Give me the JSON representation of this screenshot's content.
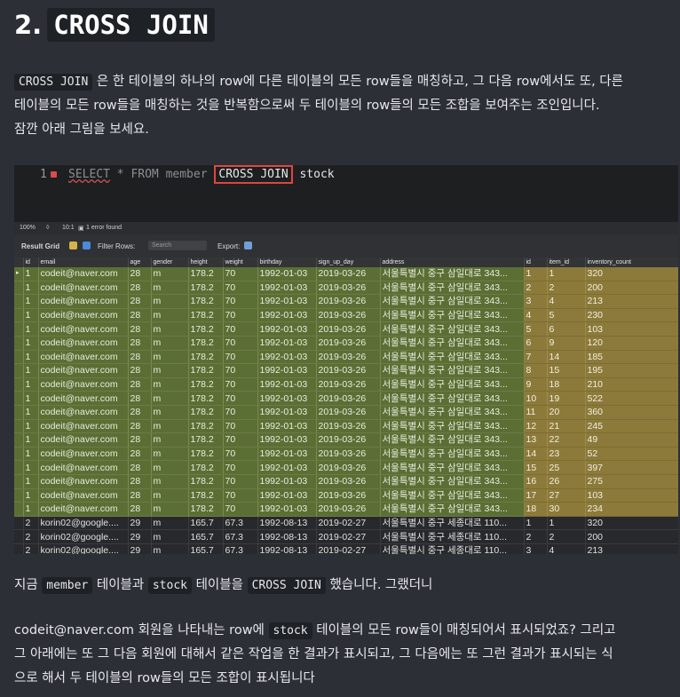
{
  "heading": {
    "number": "2.",
    "code": "CROSS JOIN"
  },
  "intro": {
    "code": "CROSS JOIN",
    "text_line1": " 은 한 테이블의 하나의 row에 다른 테이블의 모든 row들을 매칭하고, 그 다음 row에서도 또, 다른",
    "text_line2": "테이블의 모든 row들을 매칭하는 것을 반복함으로써 두 테이블의 row들의 모든 조합을 보여주는 조인입니다.",
    "text_line3": "잠깐 아래 그림을 보세요."
  },
  "editor": {
    "line_number": "1",
    "kw_select": "SELECT",
    "rest_before": " * FROM member ",
    "highlight": "CROSS JOIN",
    "table": " stock"
  },
  "statusbar": {
    "zoom": "100%",
    "position": "10:1",
    "errors": "1 error found"
  },
  "toolbar": {
    "result_grid": "Result Grid",
    "filter_rows": "Filter Rows:",
    "search_placeholder": "Search",
    "export": "Export:"
  },
  "columns": [
    "id",
    "email",
    "age",
    "gender",
    "height",
    "weight",
    "birthday",
    "sign_up_day",
    "address",
    "id",
    "item_id",
    "inventory_count"
  ],
  "rows": [
    [
      "1",
      "codeit@naver.com",
      "28",
      "m",
      "178.2",
      "70",
      "1992-01-03",
      "2019-03-26",
      "서울특별시 중구 삼일대로 343...",
      "1",
      "1",
      "320"
    ],
    [
      "1",
      "codeit@naver.com",
      "28",
      "m",
      "178.2",
      "70",
      "1992-01-03",
      "2019-03-26",
      "서울특별시 중구 삼일대로 343...",
      "2",
      "2",
      "200"
    ],
    [
      "1",
      "codeit@naver.com",
      "28",
      "m",
      "178.2",
      "70",
      "1992-01-03",
      "2019-03-26",
      "서울특별시 중구 삼일대로 343...",
      "3",
      "4",
      "213"
    ],
    [
      "1",
      "codeit@naver.com",
      "28",
      "m",
      "178.2",
      "70",
      "1992-01-03",
      "2019-03-26",
      "서울특별시 중구 삼일대로 343...",
      "4",
      "5",
      "230"
    ],
    [
      "1",
      "codeit@naver.com",
      "28",
      "m",
      "178.2",
      "70",
      "1992-01-03",
      "2019-03-26",
      "서울특별시 중구 삼일대로 343...",
      "5",
      "6",
      "103"
    ],
    [
      "1",
      "codeit@naver.com",
      "28",
      "m",
      "178.2",
      "70",
      "1992-01-03",
      "2019-03-26",
      "서울특별시 중구 삼일대로 343...",
      "6",
      "9",
      "120"
    ],
    [
      "1",
      "codeit@naver.com",
      "28",
      "m",
      "178.2",
      "70",
      "1992-01-03",
      "2019-03-26",
      "서울특별시 중구 삼일대로 343...",
      "7",
      "14",
      "185"
    ],
    [
      "1",
      "codeit@naver.com",
      "28",
      "m",
      "178.2",
      "70",
      "1992-01-03",
      "2019-03-26",
      "서울특별시 중구 삼일대로 343...",
      "8",
      "15",
      "195"
    ],
    [
      "1",
      "codeit@naver.com",
      "28",
      "m",
      "178.2",
      "70",
      "1992-01-03",
      "2019-03-26",
      "서울특별시 중구 삼일대로 343...",
      "9",
      "18",
      "210"
    ],
    [
      "1",
      "codeit@naver.com",
      "28",
      "m",
      "178.2",
      "70",
      "1992-01-03",
      "2019-03-26",
      "서울특별시 중구 삼일대로 343...",
      "10",
      "19",
      "522"
    ],
    [
      "1",
      "codeit@naver.com",
      "28",
      "m",
      "178.2",
      "70",
      "1992-01-03",
      "2019-03-26",
      "서울특별시 중구 삼일대로 343...",
      "11",
      "20",
      "360"
    ],
    [
      "1",
      "codeit@naver.com",
      "28",
      "m",
      "178.2",
      "70",
      "1992-01-03",
      "2019-03-26",
      "서울특별시 중구 삼일대로 343...",
      "12",
      "21",
      "245"
    ],
    [
      "1",
      "codeit@naver.com",
      "28",
      "m",
      "178.2",
      "70",
      "1992-01-03",
      "2019-03-26",
      "서울특별시 중구 삼일대로 343...",
      "13",
      "22",
      "49"
    ],
    [
      "1",
      "codeit@naver.com",
      "28",
      "m",
      "178.2",
      "70",
      "1992-01-03",
      "2019-03-26",
      "서울특별시 중구 삼일대로 343...",
      "14",
      "23",
      "52"
    ],
    [
      "1",
      "codeit@naver.com",
      "28",
      "m",
      "178.2",
      "70",
      "1992-01-03",
      "2019-03-26",
      "서울특별시 중구 삼일대로 343...",
      "15",
      "25",
      "397"
    ],
    [
      "1",
      "codeit@naver.com",
      "28",
      "m",
      "178.2",
      "70",
      "1992-01-03",
      "2019-03-26",
      "서울특별시 중구 삼일대로 343...",
      "16",
      "26",
      "275"
    ],
    [
      "1",
      "codeit@naver.com",
      "28",
      "m",
      "178.2",
      "70",
      "1992-01-03",
      "2019-03-26",
      "서울특별시 중구 삼일대로 343...",
      "17",
      "27",
      "103"
    ],
    [
      "1",
      "codeit@naver.com",
      "28",
      "m",
      "178.2",
      "70",
      "1992-01-03",
      "2019-03-26",
      "서울특별시 중구 삼일대로 343...",
      "18",
      "30",
      "234"
    ],
    [
      "2",
      "korin02@google....",
      "29",
      "m",
      "165.7",
      "67.3",
      "1992-08-13",
      "2019-02-27",
      "서울특별시 중구 세종대로 110...",
      "1",
      "1",
      "320"
    ],
    [
      "2",
      "korin02@google....",
      "29",
      "m",
      "165.7",
      "67.3",
      "1992-08-13",
      "2019-02-27",
      "서울특별시 중구 세종대로 110...",
      "2",
      "2",
      "200"
    ],
    [
      "2",
      "korin02@google....",
      "29",
      "m",
      "165.7",
      "67.3",
      "1992-08-13",
      "2019-02-27",
      "서울특별시 중구 세종대로 110...",
      "3",
      "4",
      "213"
    ]
  ],
  "highlighted_row_count": 18,
  "para2": {
    "t1": "지금 ",
    "c1": "member",
    "t2": " 테이블과 ",
    "c2": "stock",
    "t3": " 테이블을 ",
    "c3": "CROSS JOIN",
    "t4": " 했습니다. 그랬더니"
  },
  "para3": {
    "t1": "codeit@naver.com 회원을 나타내는 row에 ",
    "c1": "stock",
    "t2": " 테이블의 모든 row들이 매칭되어서 표시되었죠? 그리고",
    "line2": "그 아래에는 또 그 다음 회원에 대해서 같은 작업을 한 결과가 표시되고, 그 다음에는 또 그런 결과가 표시되는 식",
    "line3": "으로 해서 두 테이블의 row들의 모든 조합이 표시됩니다"
  }
}
